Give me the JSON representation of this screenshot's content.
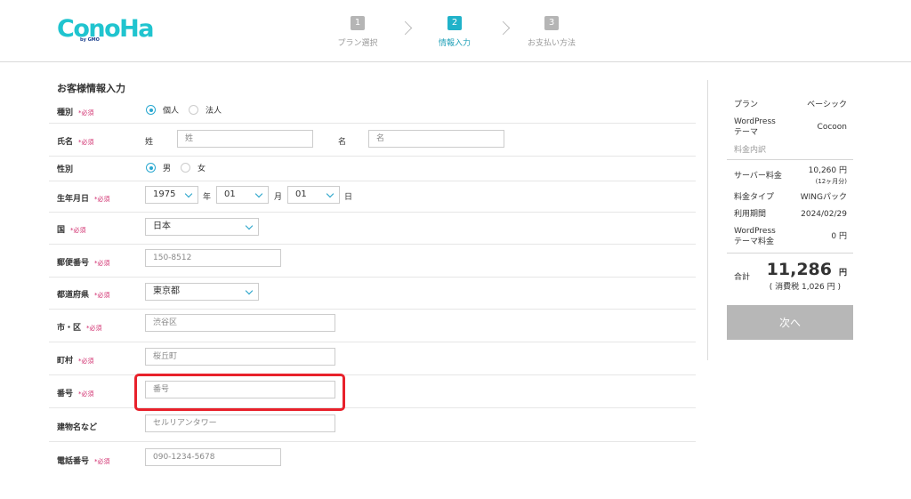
{
  "header": {
    "logo_text": "ConoHa",
    "logo_sub": "by GMO",
    "steps": [
      {
        "num": "1",
        "label": "プラン選択"
      },
      {
        "num": "2",
        "label": "情報入力"
      },
      {
        "num": "3",
        "label": "お支払い方法"
      }
    ],
    "active_step": 2
  },
  "form": {
    "title": "お客様情報入力",
    "required_mark": "*必須",
    "type": {
      "label": "種別",
      "options": [
        "個人",
        "法人"
      ],
      "selected": "個人"
    },
    "name": {
      "label": "氏名",
      "sei_label": "姓",
      "sei_placeholder": "姓",
      "mei_label": "名",
      "mei_placeholder": "名"
    },
    "gender": {
      "label": "性別",
      "options": [
        "男",
        "女"
      ],
      "selected": "男"
    },
    "birth": {
      "label": "生年月日",
      "year": "1975",
      "year_unit": "年",
      "month": "01",
      "month_unit": "月",
      "day": "01",
      "day_unit": "日"
    },
    "country": {
      "label": "国",
      "value": "日本"
    },
    "postal": {
      "label": "郵便番号",
      "placeholder": "150-8512"
    },
    "prefecture": {
      "label": "都道府県",
      "value": "東京都"
    },
    "city": {
      "label": "市・区",
      "placeholder": "渋谷区"
    },
    "town": {
      "label": "町村",
      "placeholder": "桜丘町"
    },
    "number": {
      "label": "番号",
      "placeholder": "番号"
    },
    "building": {
      "label": "建物名など",
      "placeholder": "セルリアンタワー"
    },
    "phone": {
      "label": "電話番号",
      "placeholder": "090-1234-5678"
    }
  },
  "summary": {
    "plan_label": "プラン",
    "plan_value": "ベーシック",
    "theme_label_1": "WordPress",
    "theme_label_2": "テーマ",
    "theme_value": "Cocoon",
    "breakdown_label": "料金内訳",
    "server_fee_label": "サーバー料金",
    "server_fee_value": "10,260 円",
    "server_fee_note": "(12ヶ月分)",
    "fee_type_label": "料金タイプ",
    "fee_type_value": "WINGパック",
    "period_label": "利用期間",
    "period_value": "2024/02/29",
    "theme_fee_label_1": "WordPress",
    "theme_fee_label_2": "テーマ料金",
    "theme_fee_value": "0 円",
    "total_label": "合計",
    "total_value": "11,286",
    "total_unit": "円",
    "tax_note": "( 消費税 1,026 円 )",
    "next_button": "次へ"
  },
  "colors": {
    "accent": "#20b2c9",
    "required": "#d0296b",
    "highlight": "#e8212b",
    "disabled_button": "#b7b7b7"
  }
}
